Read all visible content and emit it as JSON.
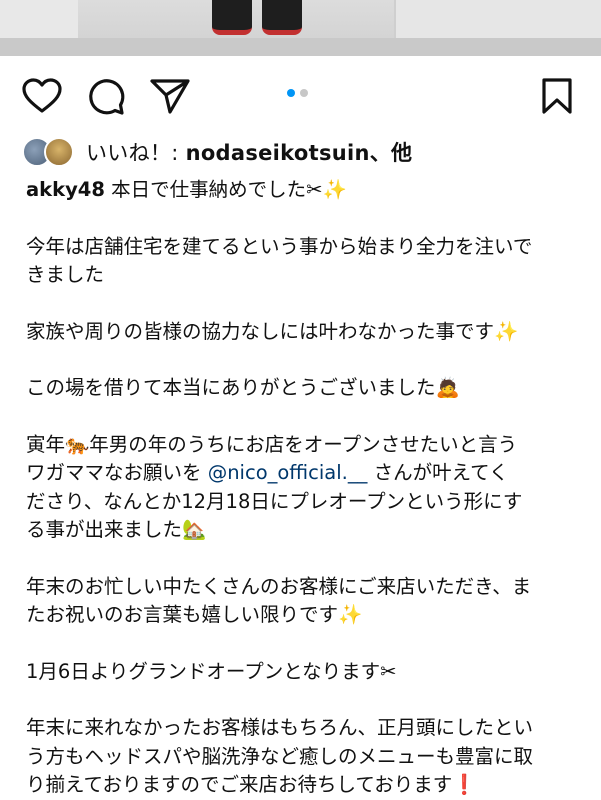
{
  "post": {
    "carousel": {
      "dot_count": 2,
      "active_index": 0
    },
    "likes": {
      "prefix": "いいね！: ",
      "user": "nodaseikotsuin",
      "suffix": "、他"
    },
    "caption": {
      "username": "akky48",
      "first_line": " 本日で仕事納めでした✂✨",
      "p2_line1": "今年は店舗住宅を建てるという事から始まり全力を注いで",
      "p2_line2": "きました",
      "p3": "家族や周りの皆様の協力なしには叶わなかった事です✨",
      "p4": "この場を借りて本当にありがとうございました🙇",
      "p5_line1": "寅年🐅年男の年のうちにお店をオープンさせたいと言う",
      "p5_line2_before": "ワガママなお願いを ",
      "p5_mention": "@nico_official.__",
      "p5_line2_after": " さんが叶えてく",
      "p5_line3": "ださり、なんとか12月18日にプレオープンという形にす",
      "p5_line4": "る事が出来ました🏡",
      "p6_line1": "年末のお忙しい中たくさんのお客様にご来店いただき、ま",
      "p6_line2": "たお祝いのお言葉も嬉しい限りです✨",
      "p7": "1月6日よりグランドオープンとなります✂",
      "p8_line1": "年末に来れなかったお客様はもちろん、正月頭にしたとい",
      "p8_line2": "う方もヘッドスパや脳洗浄など癒しのメニューも豊富に取",
      "p8_line3": "り揃えておりますのでご来店お待ちしております❗"
    }
  },
  "icons": {
    "like": "heart-outline-icon",
    "comment": "speech-bubble-icon",
    "share": "paper-plane-icon",
    "save": "bookmark-icon"
  },
  "colors": {
    "text": "#111111",
    "dot_active": "#0095f6",
    "dot_inactive": "#c7c7c7",
    "mention": "#00376b"
  }
}
